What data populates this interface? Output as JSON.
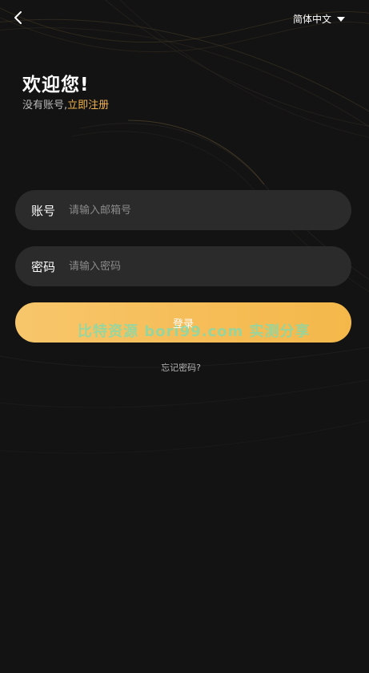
{
  "header": {
    "back_icon": "chevron-left-icon",
    "language": "简体中文",
    "language_caret_icon": "caret-down-icon"
  },
  "welcome": {
    "title": "欢迎您!",
    "no_account_text": "没有账号,",
    "register_link": "立即注册"
  },
  "form": {
    "account_label": "账号",
    "account_placeholder": "请输入邮箱号",
    "password_label": "密码",
    "password_placeholder": "请输入密码",
    "login_label": "登录",
    "forgot_label": "忘记密码?"
  },
  "watermark": {
    "text": "比特资源 bori99.com 实测分享"
  },
  "colors": {
    "background": "#131313",
    "input_background": "#2b2b2b",
    "accent": "#f2b34c",
    "button_gradient_start": "#f7c66b",
    "button_gradient_end": "#f4b84a"
  }
}
